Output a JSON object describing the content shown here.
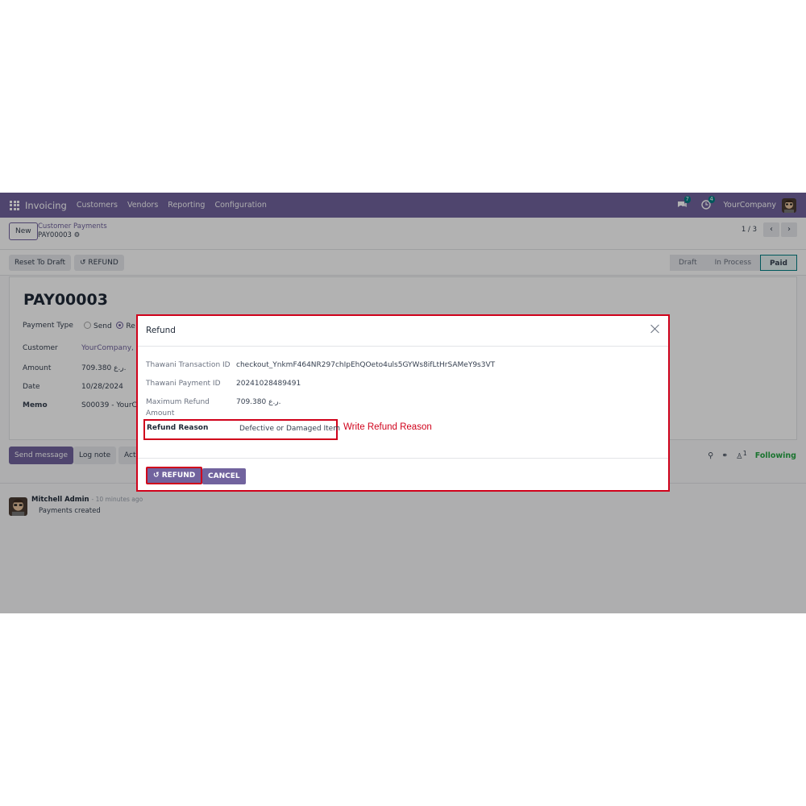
{
  "navbar": {
    "app_name": "Invoicing",
    "menus": [
      "Customers",
      "Vendors",
      "Reporting",
      "Configuration"
    ],
    "messages_count": "7",
    "activities_count": "4",
    "company": "YourCompany",
    "accent_color": "#71639e"
  },
  "control": {
    "new_label": "New",
    "breadcrumb_parent": "Customer Payments",
    "breadcrumb_current": "PAY00003",
    "pager": "1 / 3"
  },
  "statusbar": {
    "reset_label": "Reset To Draft",
    "refund_label": "REFUND",
    "stages": [
      "Draft",
      "In Process",
      "Paid"
    ],
    "active_stage": "Paid"
  },
  "form": {
    "title": "PAY00003",
    "payment_type_label": "Payment Type",
    "payment_type_send": "Send",
    "payment_type_receive": "Re",
    "customer_label": "Customer",
    "customer_value": "YourCompany, M",
    "amount_label": "Amount",
    "amount_value": "709.380 ر.ع.",
    "date_label": "Date",
    "date_value": "10/28/2024",
    "memo_label": "Memo",
    "memo_value": "S00039 - YourC"
  },
  "chatter": {
    "send_message": "Send message",
    "log_note": "Log note",
    "activities": "Act",
    "followers_count": "1",
    "following": "Following",
    "author": "Mitchell Admin",
    "time": "- 10 minutes ago",
    "body": "Payments created"
  },
  "dialog": {
    "title": "Refund",
    "fields": [
      {
        "label": "Thawani Transaction ID",
        "value": "checkout_YnkmF464NR297chIpEhQOeto4uls5GYWs8ifLtHrSAMeY9s3VT"
      },
      {
        "label": "Thawani Payment ID",
        "value": "20241028489491"
      },
      {
        "label": "Maximum Refund Amount",
        "value": "709.380 ر.ع."
      }
    ],
    "reason_label": "Refund Reason",
    "reason_value": "Defective or Damaged Item",
    "reason_hint": "Write Refund Reason",
    "refund_button": "REFUND",
    "cancel_button": "CANCEL",
    "highlight_color": "#d0021b"
  }
}
